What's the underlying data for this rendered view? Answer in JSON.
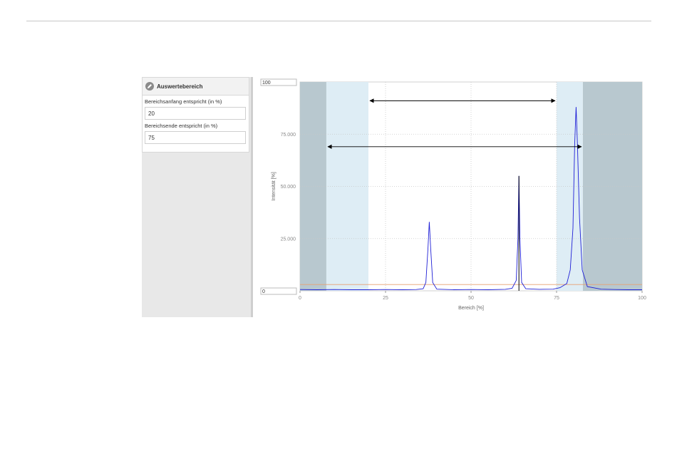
{
  "panel": {
    "title": "Auswertebereich",
    "icon": "pencil-icon",
    "start_label": "Bereichsanfang entspricht (in %)",
    "start_value": "20",
    "end_label": "Bereichsende entspricht (in %)",
    "end_value": "75"
  },
  "chart": {
    "ymax_box": "100",
    "ymin_box": "0"
  },
  "chart_data": {
    "type": "line",
    "xlabel": "Bereich [%]",
    "ylabel": "Intensität [%]",
    "xlim": [
      0,
      100
    ],
    "ylim": [
      0,
      100
    ],
    "x_ticks": [
      "0",
      "25",
      "50",
      "75",
      "100"
    ],
    "y_ticks": [
      "25.000",
      "50.000",
      "75.000"
    ],
    "grid": true,
    "colors": {
      "series": "#1f1fd6",
      "threshold": "#e8a070",
      "outer_shade": "#b8c8cf",
      "inner_shade": "#deedf5",
      "marker": "#000000"
    },
    "regions": {
      "outer_left": [
        0,
        7.7
      ],
      "inner_left": [
        7.7,
        20
      ],
      "inner_right": [
        75,
        82.7
      ],
      "outer_right": [
        82.7,
        100
      ]
    },
    "arrows": [
      {
        "from": 20,
        "to": 75,
        "y": 91
      },
      {
        "from": 7.7,
        "to": 82.7,
        "y": 69
      }
    ],
    "threshold_y": 3,
    "marker_x": 64,
    "series": [
      {
        "x": [
          0,
          5,
          10,
          15,
          20,
          25,
          30,
          34,
          36,
          36.8,
          37.4,
          37.8,
          38.2,
          38.8,
          40,
          45,
          50,
          55,
          60,
          62,
          63.2,
          63.7,
          64,
          64.3,
          64.8,
          66,
          70,
          74,
          76,
          78,
          79,
          79.8,
          80.3,
          80.7,
          81.1,
          81.7,
          82.5,
          84,
          88,
          92,
          96,
          100
        ],
        "y": [
          0.6,
          0.5,
          0.6,
          0.5,
          0.5,
          0.6,
          0.5,
          0.6,
          1.0,
          4,
          20,
          33,
          20,
          4,
          0.8,
          0.5,
          0.6,
          0.5,
          0.7,
          1.2,
          5,
          25,
          55,
          25,
          4,
          1.0,
          0.7,
          0.8,
          1.5,
          3.5,
          10,
          30,
          70,
          88,
          70,
          35,
          10,
          2,
          0.8,
          0.6,
          0.5,
          0.5
        ]
      }
    ]
  }
}
